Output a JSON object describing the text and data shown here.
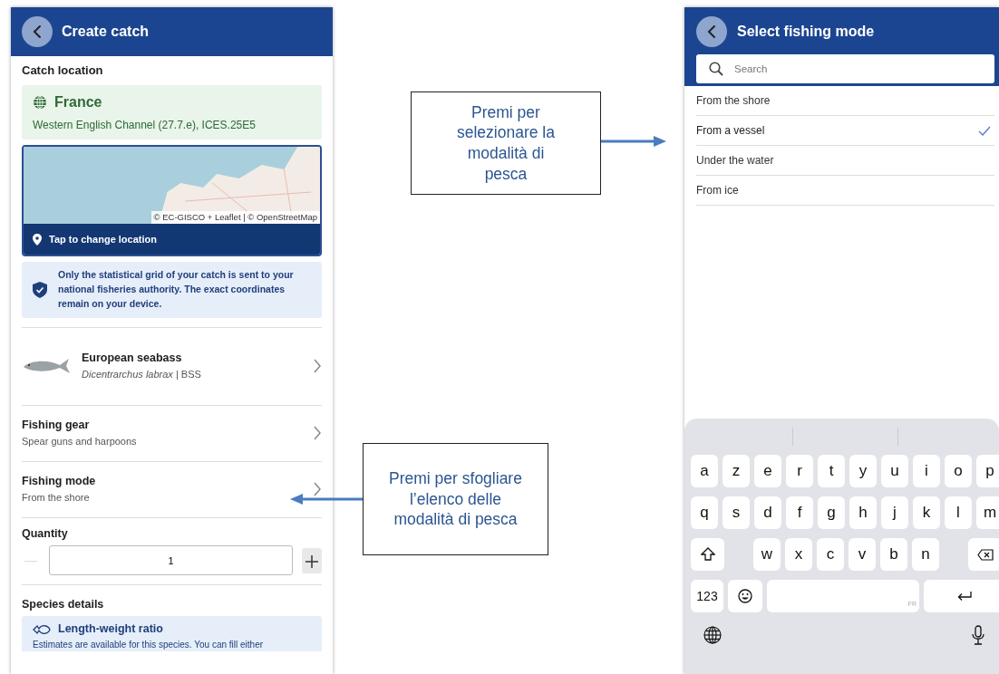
{
  "left_screen": {
    "header": {
      "title": "Create catch"
    },
    "catch_location": {
      "heading": "Catch location",
      "country": "France",
      "area": "Western English Channel (27.7.e), ICES.25E5",
      "map_attribution": "© EC-GISCO + Leaflet | © OpenStreetMap",
      "change_location": "Tap to change location",
      "privacy_note": "Only the statistical grid of your catch is sent to your national fisheries authority. The exact coordinates remain on your device."
    },
    "species": {
      "name": "European seabass",
      "subtitle": "*Dicentrarchus labrax* | BSS"
    },
    "fields": [
      {
        "label": "Fishing gear",
        "value": "Spear guns and harpoons"
      },
      {
        "label": "Fishing mode",
        "value": "From the shore"
      }
    ],
    "quantity": {
      "label": "Quantity",
      "value": "1",
      "decrement_disabled": true
    },
    "species_details": {
      "heading": "Species details",
      "card_title": "Length-weight ratio",
      "card_text": "Estimates are available for this species. You can fill either"
    }
  },
  "right_screen": {
    "header": {
      "title": "Select fishing mode"
    },
    "search": {
      "placeholder": "Search"
    },
    "options": [
      {
        "label": "From the shore",
        "selected": false
      },
      {
        "label": "From a vessel",
        "selected": true
      },
      {
        "label": "Under the water",
        "selected": false
      },
      {
        "label": "From ice",
        "selected": false
      }
    ],
    "keyboard": {
      "letter_rows": [
        [
          "a",
          "z",
          "e",
          "r",
          "t",
          "y",
          "u",
          "i",
          "o",
          "p"
        ],
        [
          "q",
          "s",
          "d",
          "f",
          "g",
          "h",
          "j",
          "k",
          "l",
          "m"
        ],
        [
          "w",
          "x",
          "c",
          "v",
          "b",
          "n"
        ]
      ],
      "numbers_key": "123",
      "space_language": "FR"
    }
  },
  "callouts": [
    {
      "text": "Premi per selezionare la modalità di pesca"
    },
    {
      "text": "Premi per sfogliare l’elenco delle modalità di pesca"
    }
  ]
}
